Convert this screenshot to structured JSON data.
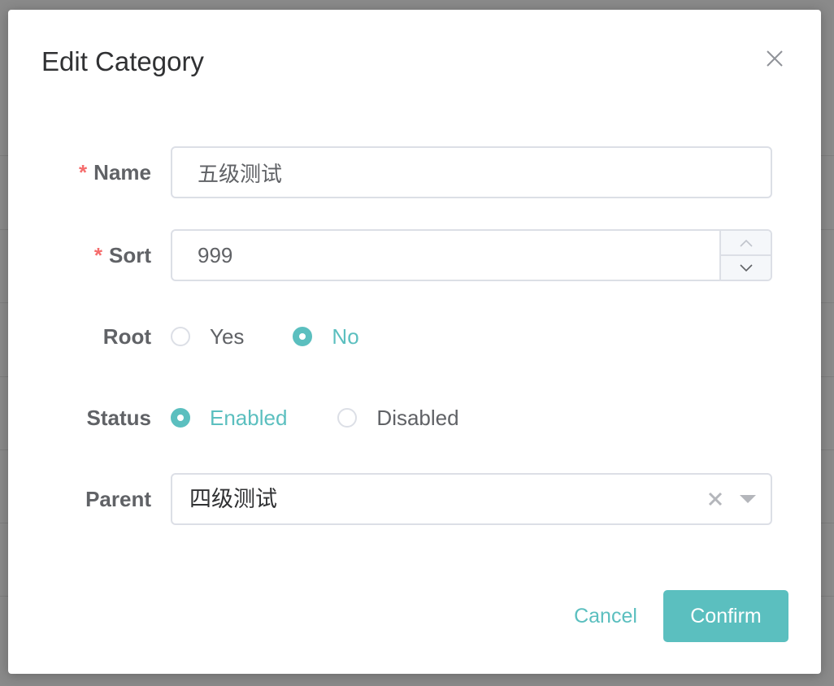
{
  "dialog": {
    "title": "Edit Category",
    "close_icon": "close-icon"
  },
  "form": {
    "name": {
      "label": "Name",
      "required_mark": "*",
      "value": "五级测试"
    },
    "sort": {
      "label": "Sort",
      "required_mark": "*",
      "value": "999",
      "increase_icon": "chevron-up-icon",
      "decrease_icon": "chevron-down-icon"
    },
    "root": {
      "label": "Root",
      "options": [
        {
          "label": "Yes",
          "checked": false
        },
        {
          "label": "No",
          "checked": true
        }
      ]
    },
    "status": {
      "label": "Status",
      "options": [
        {
          "label": "Enabled",
          "checked": true
        },
        {
          "label": "Disabled",
          "checked": false
        }
      ]
    },
    "parent": {
      "label": "Parent",
      "value": "四级测试",
      "clear_icon": "clear-icon",
      "arrow_icon": "caret-down-icon"
    }
  },
  "footer": {
    "cancel_label": "Cancel",
    "confirm_label": "Confirm"
  },
  "colors": {
    "accent": "#5bbfbf",
    "required": "#f56c6c",
    "label": "#606266",
    "border": "#dcdfe6",
    "overlay": "#8a8a8a"
  }
}
